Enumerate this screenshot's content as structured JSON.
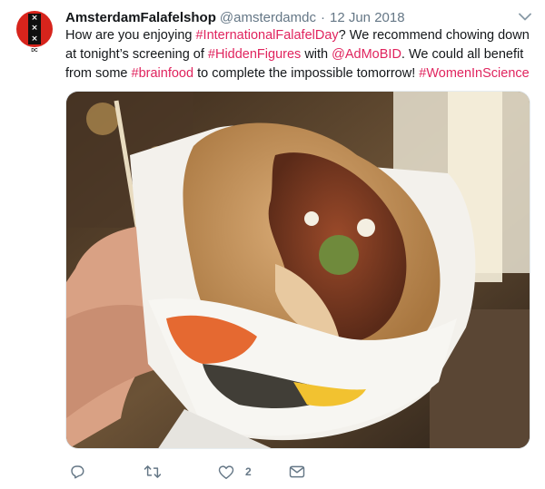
{
  "tweet": {
    "avatar": {
      "marks": [
        "×",
        "×",
        "×"
      ],
      "caption": "DC"
    },
    "display_name": "AmsterdamFalafelshop",
    "handle": "@amsterdamdc",
    "separator": "·",
    "date": "12 Jun 2018",
    "text_segments": [
      {
        "text": "How are you enjoying ",
        "link": false
      },
      {
        "text": "#InternationalFalafelDay",
        "link": true
      },
      {
        "text": "? We recommend chowing down at tonight’s screening of ",
        "link": false
      },
      {
        "text": "#HiddenFigures",
        "link": true
      },
      {
        "text": " with ",
        "link": false
      },
      {
        "text": "@AdMoBID",
        "link": true
      },
      {
        "text": ". We could all benefit from some ",
        "link": false
      },
      {
        "text": "#brainfood",
        "link": true
      },
      {
        "text": " to complete the impossible tomorrow! ",
        "link": false
      },
      {
        "text": "#WomenInScience",
        "link": true
      }
    ],
    "actions": {
      "reply_icon": "reply-icon",
      "retweet_icon": "retweet-icon",
      "like_icon": "heart-icon",
      "like_count": "2",
      "dm_icon": "envelope-icon"
    }
  },
  "colors": {
    "link": "#e0245e",
    "text": "#14171a",
    "muted": "#657786",
    "avatar_red": "#d7241c"
  }
}
